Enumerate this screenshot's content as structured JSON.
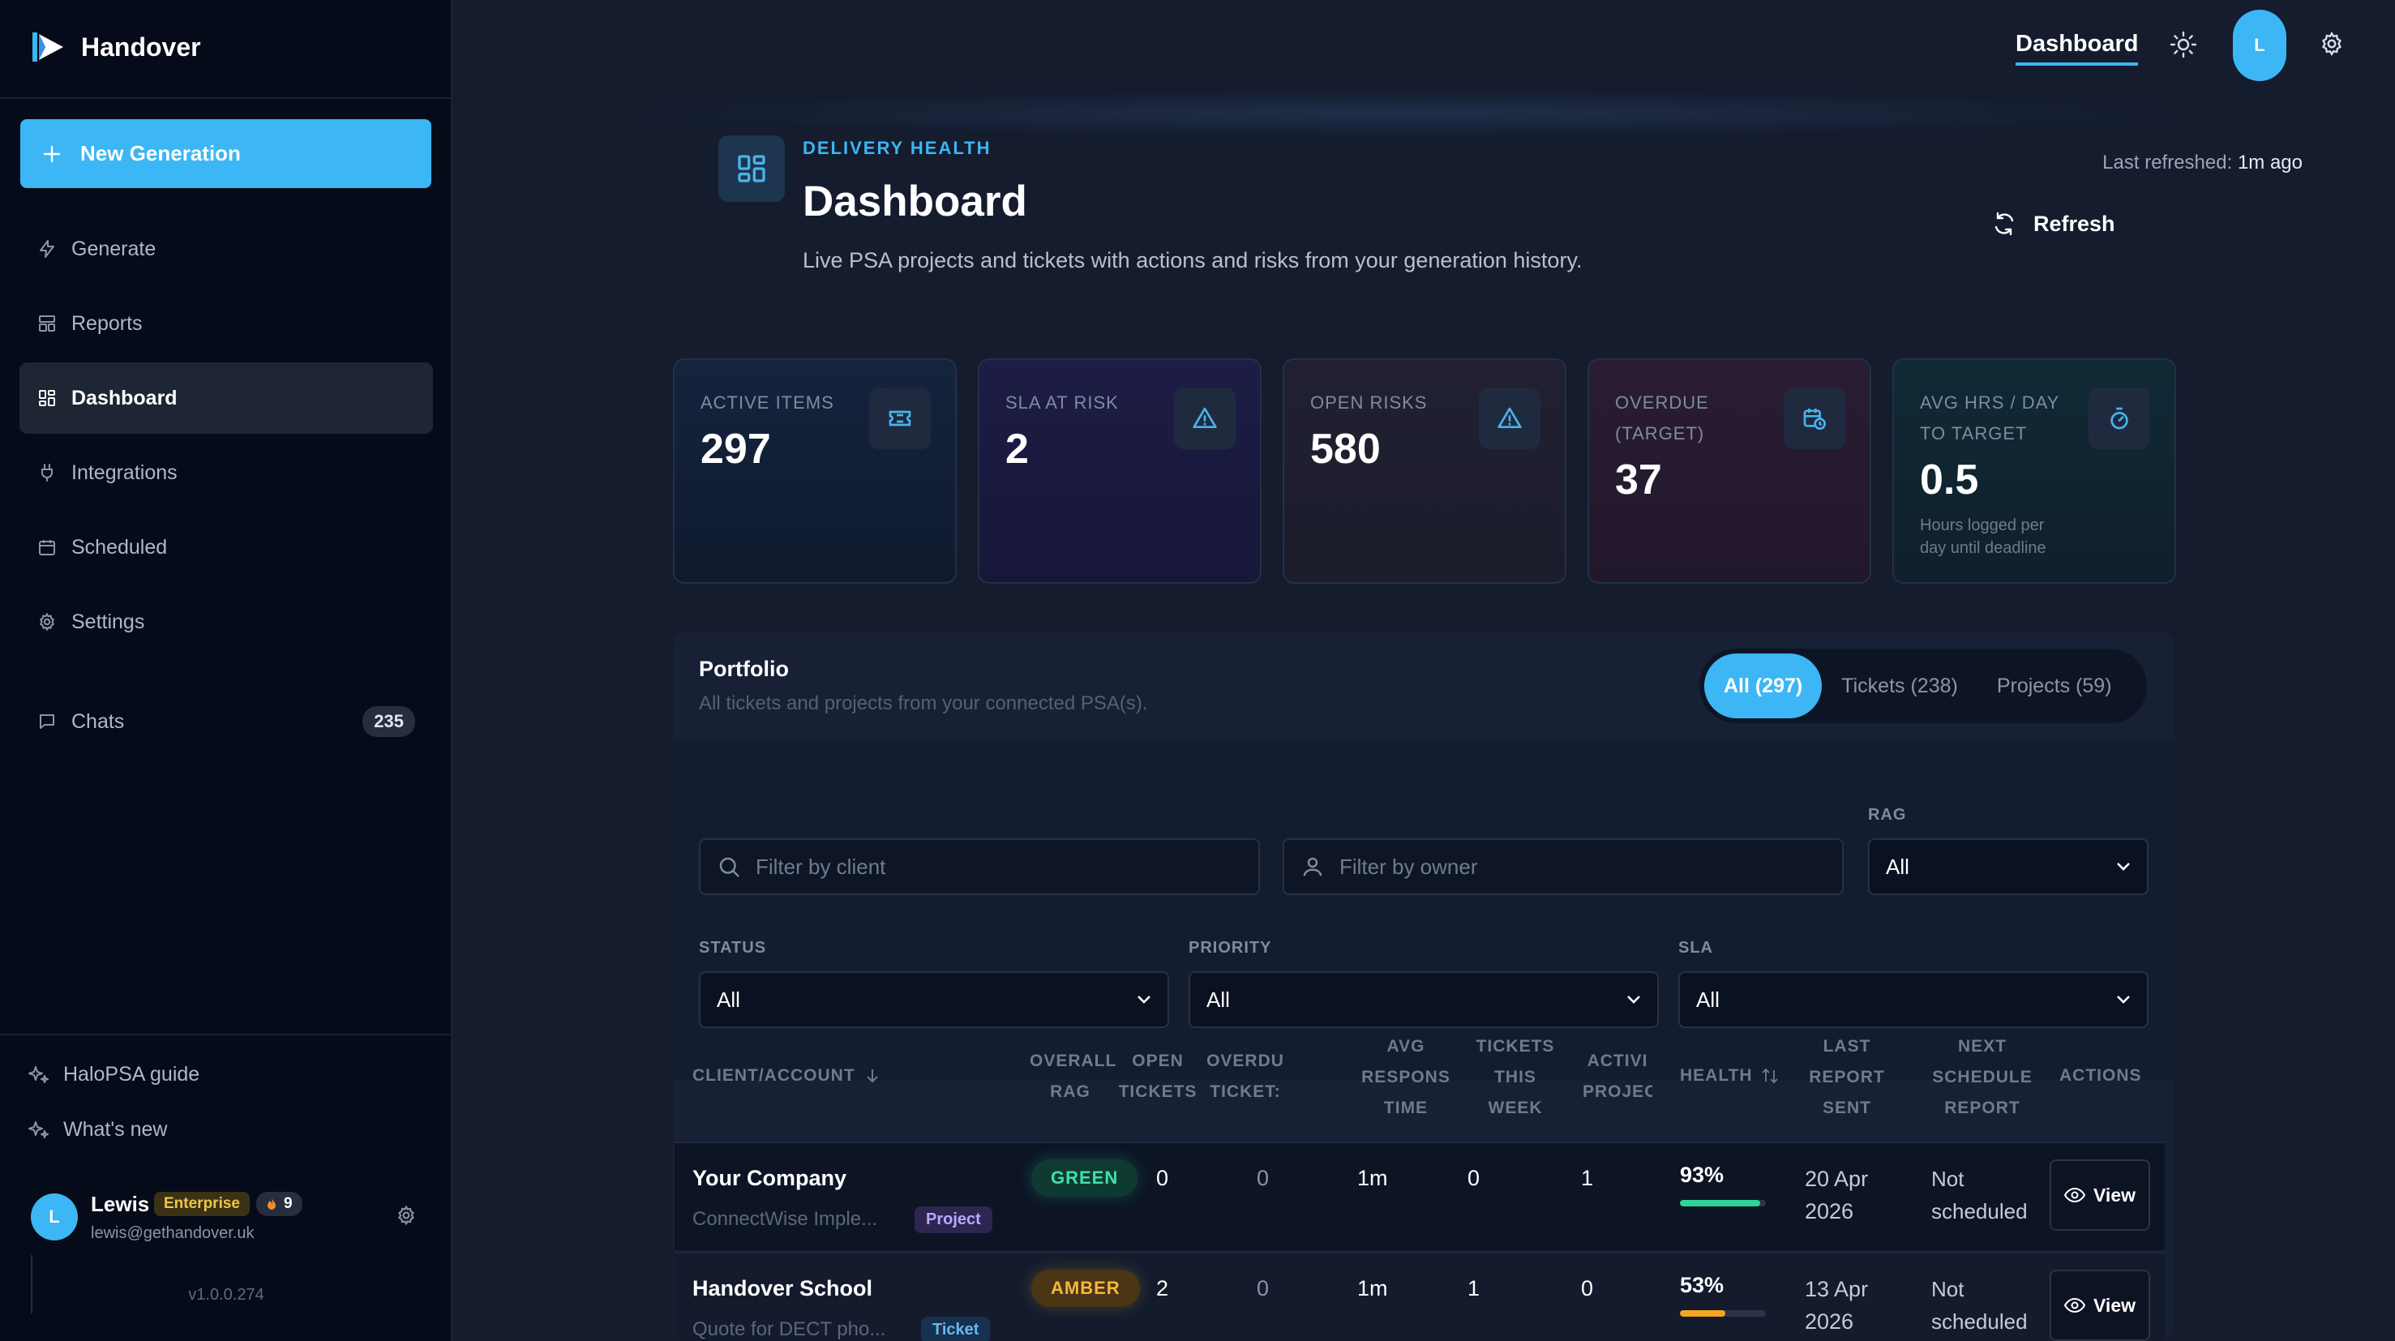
{
  "app": {
    "name": "Handover",
    "version": "v1.0.0.274"
  },
  "sidebar": {
    "new_generation": "New Generation",
    "items": [
      {
        "label": "Generate",
        "icon": "bolt-icon"
      },
      {
        "label": "Reports",
        "icon": "reports-icon"
      },
      {
        "label": "Dashboard",
        "icon": "dashboard-icon",
        "active": true
      },
      {
        "label": "Integrations",
        "icon": "plug-icon"
      },
      {
        "label": "Scheduled",
        "icon": "calendar-icon"
      },
      {
        "label": "Settings",
        "icon": "gear-icon"
      }
    ],
    "chats": {
      "label": "Chats",
      "count": "235"
    },
    "footer_links": [
      "HaloPSA guide",
      "What's new"
    ],
    "user": {
      "initial": "L",
      "name": "Lewis",
      "plan": "Enterprise",
      "streak": "9",
      "email": "lewis@gethandover.uk"
    }
  },
  "topbar": {
    "nav_link": "Dashboard",
    "avatar_initial": "L"
  },
  "header": {
    "eyebrow": "DELIVERY HEALTH",
    "title": "Dashboard",
    "subtitle": "Live PSA projects and tickets with actions and risks from your generation history.",
    "last_refreshed_label": "Last refreshed:",
    "last_refreshed_value": "1m ago",
    "refresh_label": "Refresh"
  },
  "kpis": [
    {
      "label_1": "ACTIVE ITEMS",
      "label_2": "",
      "value": "297",
      "icon": "ticket-icon",
      "note": ""
    },
    {
      "label_1": "SLA AT RISK",
      "label_2": "",
      "value": "2",
      "icon": "warning-icon",
      "note": ""
    },
    {
      "label_1": "OPEN RISKS",
      "label_2": "",
      "value": "580",
      "icon": "warning-icon",
      "note": ""
    },
    {
      "label_1": "OVERDUE",
      "label_2": "(TARGET)",
      "value": "37",
      "icon": "calendar-clock-icon",
      "note": ""
    },
    {
      "label_1": "AVG HRS / DAY",
      "label_2": "TO TARGET",
      "value": "0.5",
      "icon": "stopwatch-icon",
      "note": "Hours logged per day until deadline"
    }
  ],
  "portfolio": {
    "title": "Portfolio",
    "subtitle": "All tickets and projects from your connected PSA(s).",
    "segments": [
      {
        "label": "All (297)",
        "active": true
      },
      {
        "label": "Tickets (238)",
        "active": false
      },
      {
        "label": "Projects (59)",
        "active": false
      }
    ],
    "filters": {
      "client_placeholder": "Filter by client",
      "owner_placeholder": "Filter by owner",
      "rag_label": "RAG",
      "rag_value": "All",
      "status_label": "STATUS",
      "status_value": "All",
      "priority_label": "PRIORITY",
      "priority_value": "All",
      "sla_label": "SLA",
      "sla_value": "All"
    },
    "columns": {
      "client": "CLIENT/ACCOUNT",
      "rag_1": "OVERALL",
      "rag_2": "RAG",
      "open_1": "OPEN",
      "open_2": "TICKETS",
      "overdue_1": "OVERDU",
      "overdue_2": "TICKET:",
      "avg_1": "AVG",
      "avg_2": "RESPONS",
      "avg_3": "TIME",
      "week_1": "TICKETS",
      "week_2": "THIS",
      "week_3": "WEEK",
      "projects_1": "ACTIVI",
      "projects_2": "PROJEC",
      "health": "HEALTH",
      "last_1": "LAST",
      "last_2": "REPORT",
      "last_3": "SENT",
      "next_1": "NEXT",
      "next_2": "SCHEDULE",
      "next_3": "REPORT",
      "actions": "ACTIONS"
    },
    "rows": [
      {
        "client": "Your Company",
        "sub": "ConnectWise Imple...",
        "type": "Project",
        "rag": "GREEN",
        "open": "0",
        "overdue": "0",
        "avg": "1m",
        "week": "0",
        "projects": "1",
        "health": "93%",
        "health_value": 93,
        "last_1": "20 Apr",
        "last_2": "2026",
        "next_1": "Not",
        "next_2": "scheduled",
        "action": "View"
      },
      {
        "client": "Handover School",
        "sub": "Quote for DECT pho...",
        "type": "Ticket",
        "rag": "AMBER",
        "open": "2",
        "overdue": "0",
        "avg": "1m",
        "week": "1",
        "projects": "0",
        "health": "53%",
        "health_value": 53,
        "last_1": "13 Apr",
        "last_2": "2026",
        "next_1": "Not",
        "next_2": "scheduled",
        "action": "View"
      }
    ]
  }
}
